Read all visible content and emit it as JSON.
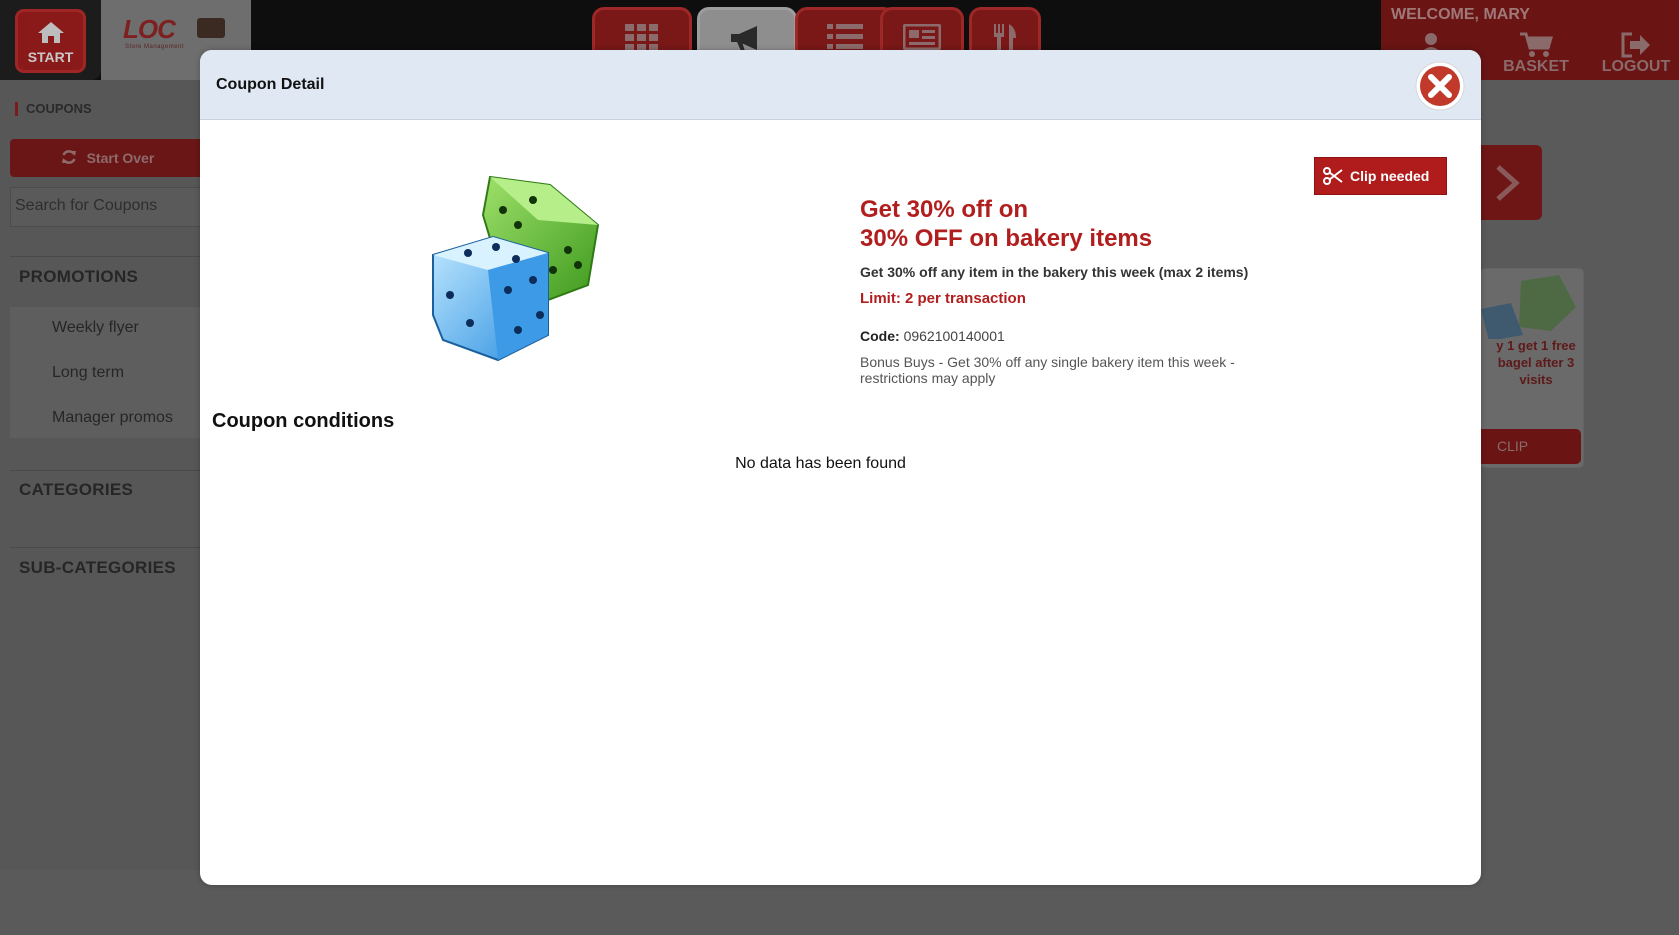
{
  "header": {
    "start_label": "START",
    "logo_text": "LOC",
    "logo_subtext": "Store Management",
    "welcome": "WELCOME, MARY",
    "basket_label": "BASKET",
    "logout_label": "LOGOUT"
  },
  "sidebar": {
    "breadcrumb": "COUPONS",
    "start_over_label": "Start Over",
    "search_placeholder": "Search for Coupons",
    "promotions_title": "PROMOTIONS",
    "promotions": [
      "Weekly flyer",
      "Long term",
      "Manager promos"
    ],
    "categories_title": "CATEGORIES",
    "subcategories_title": "SUB-CATEGORIES"
  },
  "background_card": {
    "text": "y 1 get 1 free bagel after 3 visits",
    "clip_label": "CLIP"
  },
  "modal": {
    "title": "Coupon Detail",
    "clip_label": "Clip needed",
    "offer_line1": "Get 30% off on",
    "offer_line2": "30% OFF on bakery items",
    "description": "Get 30% off any item in the bakery this week (max 2 items)",
    "limit": "Limit: 2 per transaction",
    "code_label": "Code:",
    "code_value": "0962100140001",
    "note": "Bonus Buys - Get 30% off any single bakery item this week - restrictions may apply",
    "conditions_title": "Coupon conditions",
    "no_data": "No data has been found"
  },
  "colors": {
    "accent_red": "#b11e1e",
    "modal_header_bg": "#dfe8f3",
    "nav_red": "#7a1818"
  },
  "icons": [
    "home-icon",
    "grid-icon",
    "megaphone-icon",
    "list-icon",
    "newspaper-icon",
    "restaurant-icon",
    "user-icon",
    "cart-icon",
    "logout-icon",
    "refresh-icon",
    "chevron-right-icon",
    "close-icon",
    "scissors-icon",
    "dice-icon"
  ]
}
